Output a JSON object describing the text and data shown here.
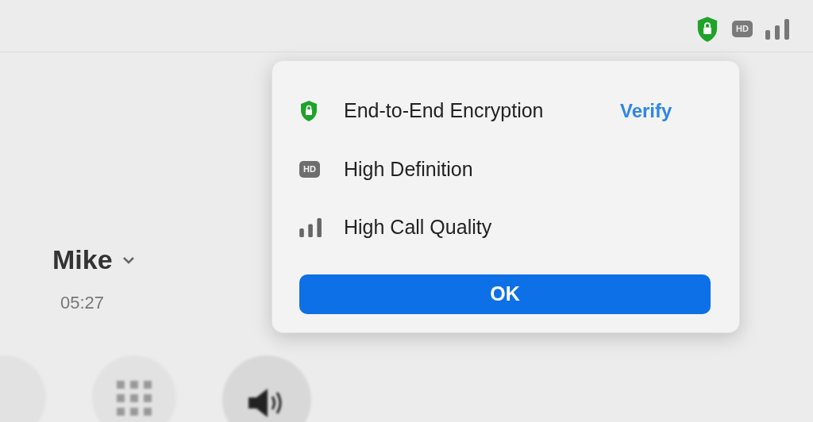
{
  "caller": {
    "name": "Mike",
    "duration": "05:27"
  },
  "popup": {
    "rows": [
      {
        "kind": "encryption",
        "label": "End-to-End Encryption",
        "action": "Verify"
      },
      {
        "kind": "hd",
        "label": "High Definition",
        "badge": "HD"
      },
      {
        "kind": "signal",
        "label": "High Call Quality"
      }
    ],
    "button": "OK"
  },
  "status_badge": "HD"
}
